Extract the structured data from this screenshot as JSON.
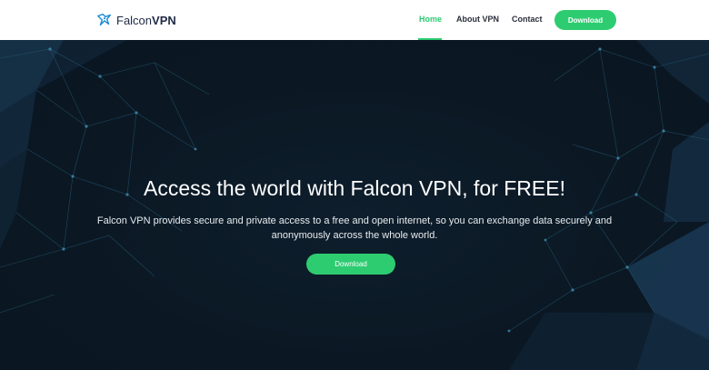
{
  "brand": {
    "name_light": "Falcon",
    "name_bold": "VPN",
    "logo_icon": "falcon-bird-icon",
    "accent_color": "#2ecc71"
  },
  "nav": {
    "items": [
      {
        "label": "Home",
        "active": true
      },
      {
        "label": "About VPN",
        "active": false
      },
      {
        "label": "Contact",
        "active": false
      }
    ],
    "download_label": "Download"
  },
  "hero": {
    "title": "Access the world with Falcon VPN, for FREE!",
    "description": "Falcon VPN provides secure and private access to a free and open internet, so you can exchange data securely and anonymously across the whole world.",
    "download_label": "Download"
  }
}
